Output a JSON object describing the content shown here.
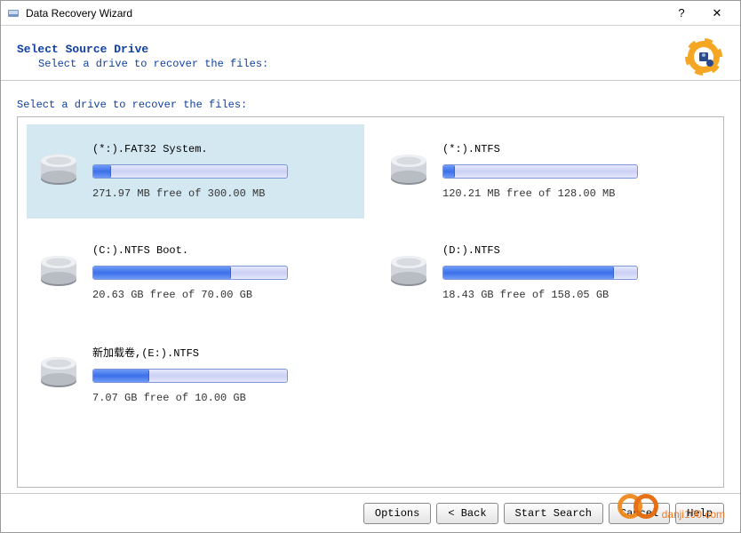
{
  "window": {
    "title": "Data Recovery Wizard",
    "help": "?",
    "close": "✕"
  },
  "header": {
    "heading": "Select Source Drive",
    "subtext": "Select a drive to recover the files:"
  },
  "instruction": "Select a drive to recover the files:",
  "drives": [
    {
      "name": "(*:).FAT32 System.",
      "free_text": "271.97 MB free of 300.00 MB",
      "used_pct": 9,
      "selected": true
    },
    {
      "name": "(*:).NTFS",
      "free_text": "120.21 MB free of 128.00 MB",
      "used_pct": 6,
      "selected": false
    },
    {
      "name": "(C:).NTFS Boot.",
      "free_text": "20.63 GB free of 70.00 GB",
      "used_pct": 71,
      "selected": false
    },
    {
      "name": "(D:).NTFS",
      "free_text": "18.43 GB free of 158.05 GB",
      "used_pct": 88,
      "selected": false
    },
    {
      "name": "新加载卷,(E:).NTFS",
      "free_text": "7.07 GB free of 10.00 GB",
      "used_pct": 29,
      "selected": false
    }
  ],
  "footer": {
    "options": "Options",
    "back": "< Back",
    "start": "Start Search",
    "cancel": "Cancel",
    "help": "Help"
  },
  "watermark": "danji100.com"
}
